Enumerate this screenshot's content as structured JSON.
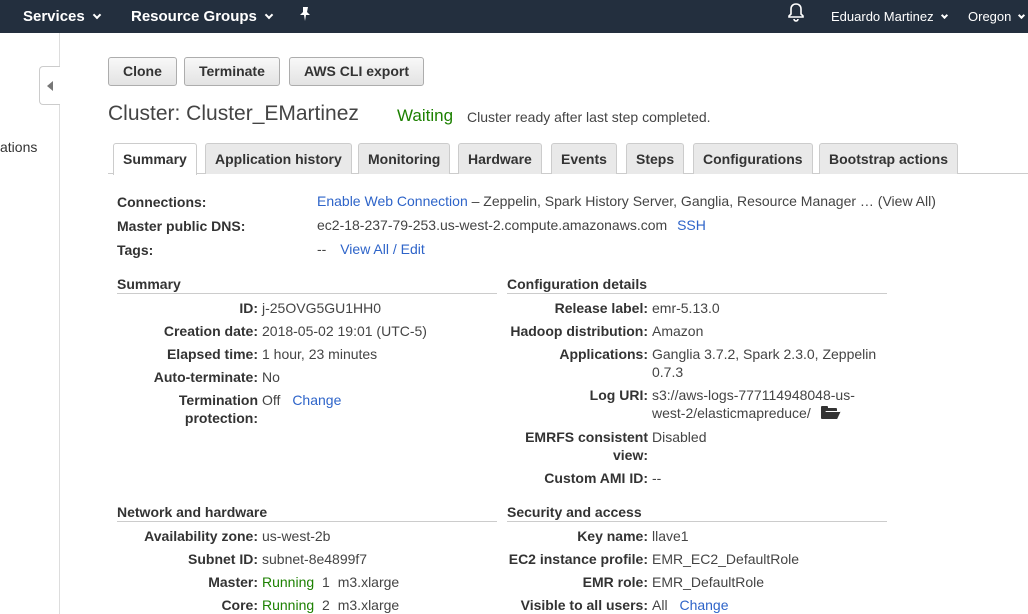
{
  "topnav": {
    "services": "Services",
    "resource_groups": "Resource Groups",
    "user": "Eduardo Martinez",
    "region": "Oregon"
  },
  "sidebar": {
    "partial_text": "ations"
  },
  "actions": {
    "clone": "Clone",
    "terminate": "Terminate",
    "cli_export": "AWS CLI export"
  },
  "header": {
    "title": "Cluster: Cluster_EMartinez",
    "status": "Waiting",
    "status_message": "Cluster ready after last step completed.",
    "status_color": "#1d8102"
  },
  "tabs": [
    "Summary",
    "Application history",
    "Monitoring",
    "Hardware",
    "Events",
    "Steps",
    "Configurations",
    "Bootstrap actions"
  ],
  "connections": {
    "label": "Connections:",
    "enable_link": "Enable Web Connection",
    "apps": "– Zeppelin, Spark History Server, Ganglia, Resource Manager … (View All)",
    "dns_label": "Master public DNS:",
    "dns_value": "ec2-18-237-79-253.us-west-2.compute.amazonaws.com",
    "ssh": "SSH",
    "tags_label": "Tags:",
    "tags_dash": "--",
    "tags_link": "View All / Edit"
  },
  "summary": {
    "title": "Summary",
    "id_label": "ID:",
    "id": "j-25OVG5GU1HH0",
    "created_label": "Creation date:",
    "created": "2018-05-02 19:01 (UTC-5)",
    "elapsed_label": "Elapsed time:",
    "elapsed": "1 hour, 23 minutes",
    "autoterm_label": "Auto-terminate:",
    "autoterm": "No",
    "termprot_label_1": "Termination",
    "termprot_label_2": "protection:",
    "termprot": "Off",
    "termprot_change": "Change"
  },
  "config": {
    "title": "Configuration details",
    "release_label": "Release label:",
    "release": "emr-5.13.0",
    "hadoop_label": "Hadoop distribution:",
    "hadoop": "Amazon",
    "apps_label": "Applications:",
    "apps_1": "Ganglia 3.7.2, Spark 2.3.0, Zeppelin",
    "apps_2": "0.7.3",
    "log_label": "Log URI:",
    "log_1": "s3://aws-logs-777114948048-us-",
    "log_2": "west-2/elasticmapreduce/",
    "emrfs_label_1": "EMRFS consistent",
    "emrfs_label_2": "view:",
    "emrfs": "Disabled",
    "ami_label": "Custom AMI ID:",
    "ami": "--"
  },
  "network": {
    "title": "Network and hardware",
    "az_label": "Availability zone:",
    "az": "us-west-2b",
    "subnet_label": "Subnet ID:",
    "subnet": "subnet-8e4899f7",
    "master_label": "Master:",
    "master_status": "Running",
    "master_count": "1",
    "master_type": "m3.xlarge",
    "core_label": "Core:",
    "core_status": "Running",
    "core_count": "2",
    "core_type": "m3.xlarge"
  },
  "security": {
    "title": "Security and access",
    "key_label": "Key name:",
    "key": "llave1",
    "ec2_label": "EC2 instance profile:",
    "ec2": "EMR_EC2_DefaultRole",
    "emr_role_label": "EMR role:",
    "emr_role": "EMR_DefaultRole",
    "visible_label": "Visible to all users:",
    "visible": "All",
    "visible_change": "Change"
  }
}
